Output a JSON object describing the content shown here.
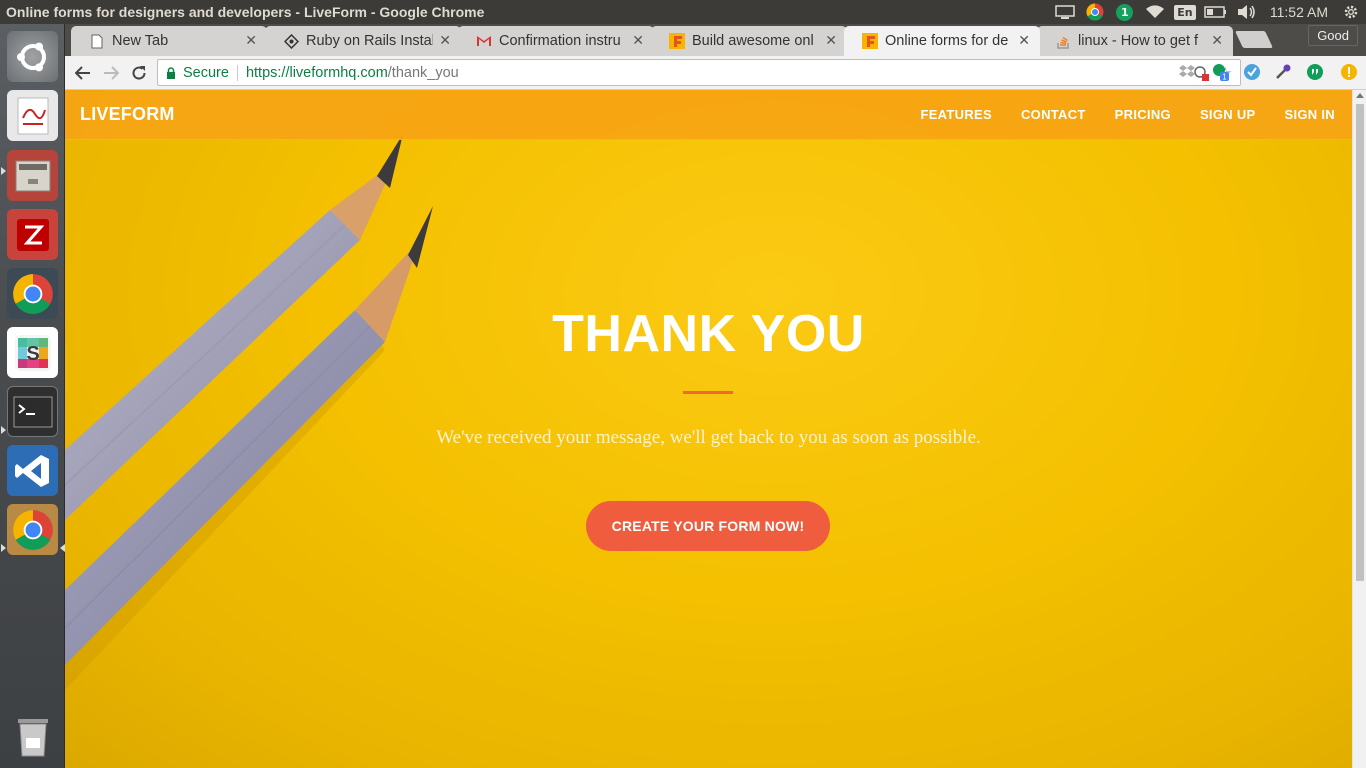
{
  "window": {
    "title": "Online forms for designers and developers - LiveForm - Google Chrome"
  },
  "tray": {
    "keyboard": "En",
    "notification_count": "1",
    "clock": "11:52 AM",
    "icons": [
      "display-icon",
      "chrome-tray-icon",
      "notification-badge-icon",
      "wifi-icon",
      "keyboard-layout-icon",
      "battery-icon",
      "volume-icon",
      "settings-gear-icon"
    ]
  },
  "launcher": {
    "items": [
      "ubuntu-dash-icon",
      "document-viewer-icon",
      "file-manager-icon",
      "filezilla-icon",
      "chrome-icon",
      "slack-icon",
      "terminal-icon",
      "vscode-icon",
      "chrome-active-icon",
      "trash-icon"
    ]
  },
  "tabs": [
    {
      "label": "New Tab",
      "icon": "page-icon"
    },
    {
      "label": "Ruby on Rails Instal",
      "icon": "rails-icon"
    },
    {
      "label": "Confirmation instru",
      "icon": "gmail-icon"
    },
    {
      "label": "Build awesome onl",
      "icon": "liveform-icon"
    },
    {
      "label": "Online forms for de",
      "icon": "liveform-icon"
    },
    {
      "label": "linux - How to get f",
      "icon": "stackoverflow-icon"
    }
  ],
  "profile": {
    "label": "Good"
  },
  "omnibox": {
    "secure_label": "Secure",
    "url_host": "https://liveformhq.com",
    "url_path": "/thank_you"
  },
  "site": {
    "brand": "LIVEFORM",
    "nav": [
      "FEATURES",
      "CONTACT",
      "PRICING",
      "SIGN UP",
      "SIGN IN"
    ],
    "title": "THANK YOU",
    "message": "We've received your message, we'll get back to you as soon as possible.",
    "cta": "CREATE YOUR FORM NOW!"
  },
  "colors": {
    "nav_bg": "#f6a414",
    "page_bg": "#f4c000",
    "accent_rule": "#ee6a35",
    "cta_bg": "#ef5d3e",
    "secure_green": "#0b8043"
  }
}
